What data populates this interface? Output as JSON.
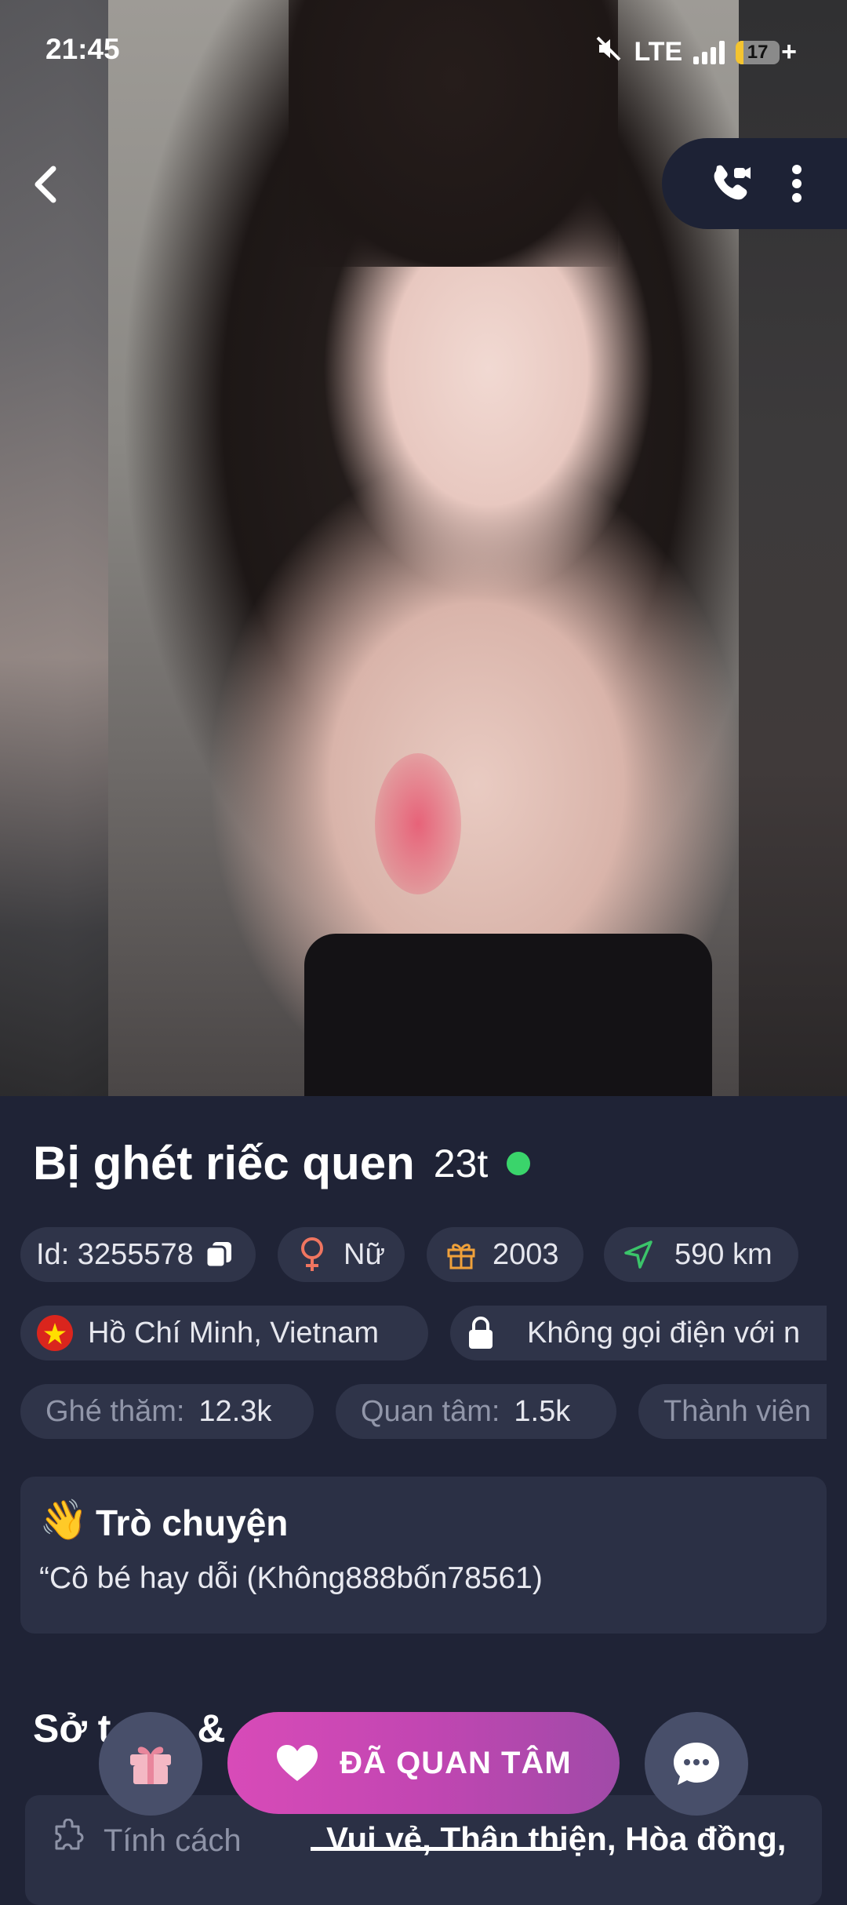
{
  "status_bar": {
    "time": "21:45",
    "network": "LTE",
    "battery": "17",
    "battery_level": 0.17,
    "charging": "+"
  },
  "header": {
    "back_icon": "chevron-left-icon",
    "call_icon": "video-call-icon",
    "more_icon": "more-vertical-icon"
  },
  "profile": {
    "name": "Bị ghét riếc quen",
    "age": "23t",
    "online": true,
    "id_label": "Id: 3255578",
    "gender": "Nữ",
    "birth_year": "2003",
    "distance": "590 km",
    "location": "Hồ Chí Minh, Vietnam",
    "call_setting": "Không gọi điện với n",
    "visits_label": "Ghé thăm:",
    "visits_value": "12.3k",
    "interest_label": "Quan tâm:",
    "interest_value": "1.5k",
    "member_label": "Thành viên"
  },
  "talk": {
    "emoji": "👋",
    "title": "Trò chuyện",
    "text": "“Cô bé hay dỗi (Không888bốn78561)"
  },
  "hobbies": {
    "section_title_visible": "Sở t",
    "section_title_tail": "&",
    "traits_label": "Tính cách",
    "traits_value": "Vui vẻ, Thân thiện, Hòa đồng,"
  },
  "actions": {
    "follow_label": "ĐÃ QUAN TÂM"
  },
  "colors": {
    "background": "#1f2336",
    "chip": "#2f3449",
    "online": "#3ad46b",
    "follow_start": "#d84bb8",
    "follow_end": "#a04aa8"
  }
}
